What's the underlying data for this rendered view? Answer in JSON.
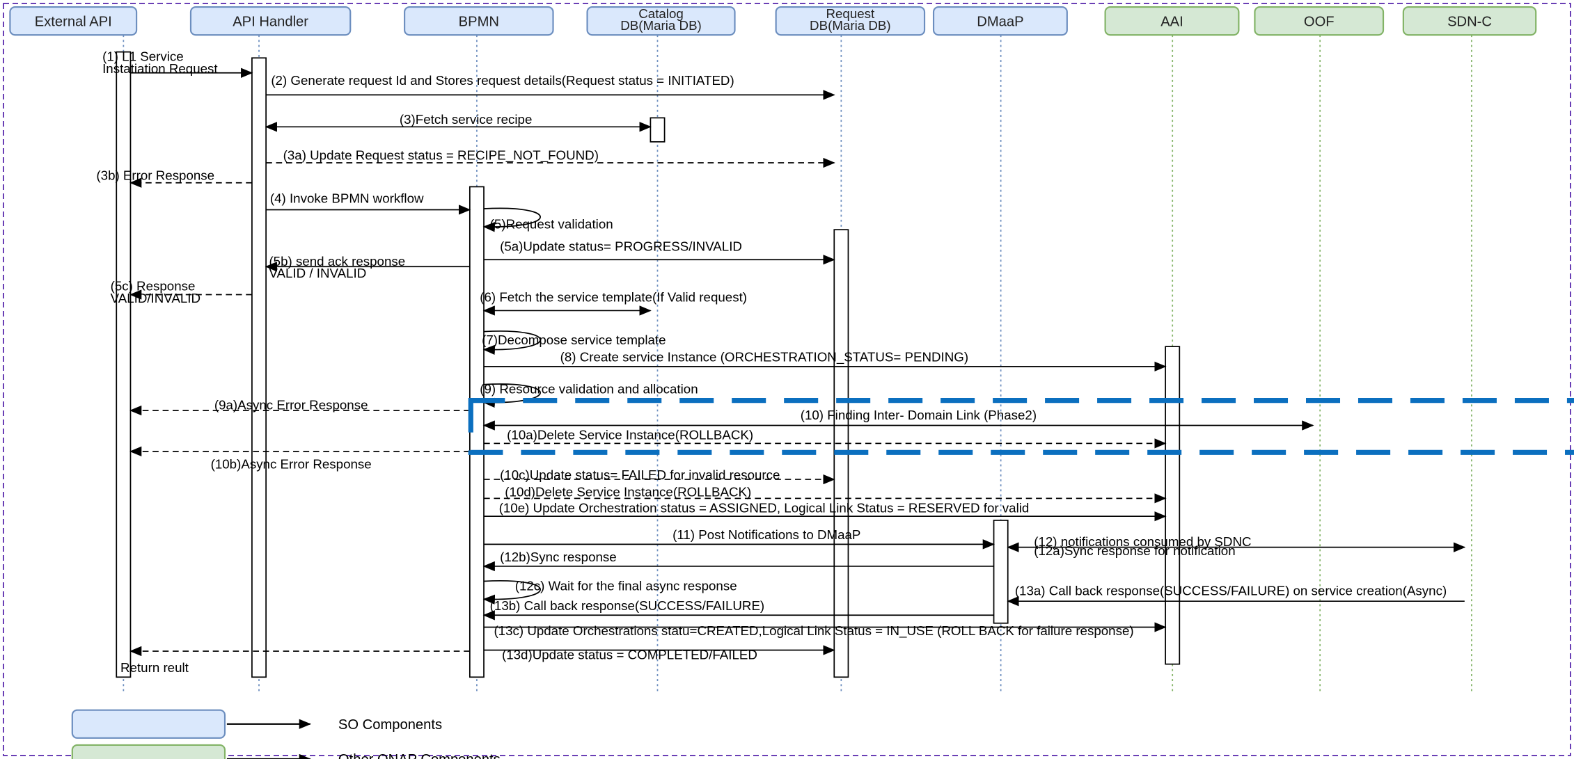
{
  "participants": [
    {
      "key": "ext",
      "label": [
        "External API"
      ],
      "group": "so"
    },
    {
      "key": "api",
      "label": [
        "API Handler"
      ],
      "group": "so"
    },
    {
      "key": "bpmn",
      "label": [
        "BPMN"
      ],
      "group": "so"
    },
    {
      "key": "cat",
      "label": [
        "Catalog",
        "DB(Maria DB)"
      ],
      "group": "so"
    },
    {
      "key": "req",
      "label": [
        "Request",
        "DB(Maria DB)"
      ],
      "group": "so"
    },
    {
      "key": "dmaap",
      "label": [
        "DMaaP"
      ],
      "group": "so"
    },
    {
      "key": "aai",
      "label": [
        "AAI"
      ],
      "group": "onap"
    },
    {
      "key": "oof",
      "label": [
        "OOF"
      ],
      "group": "onap"
    },
    {
      "key": "sdnc",
      "label": [
        "SDN-C"
      ],
      "group": "onap"
    }
  ],
  "messages": [
    {
      "id": "m1",
      "label": [
        "(1) L1 Service",
        "Instatiation Request"
      ]
    },
    {
      "id": "m2",
      "label": [
        "(2) Generate request Id and Stores request details(Request status = INITIATED)"
      ]
    },
    {
      "id": "m3",
      "label": [
        "(3)Fetch service recipe"
      ]
    },
    {
      "id": "m3a",
      "label": [
        "(3a) Update Request status = RECIPE_NOT_FOUND)"
      ]
    },
    {
      "id": "m3b",
      "label": [
        "(3b) Error Response"
      ]
    },
    {
      "id": "m4",
      "label": [
        "(4) Invoke BPMN workflow"
      ]
    },
    {
      "id": "m5",
      "label": [
        "(5)Request validation"
      ]
    },
    {
      "id": "m5a",
      "label": [
        "(5a)Update status= PROGRESS/INVALID"
      ]
    },
    {
      "id": "m5b",
      "label": [
        "(5b) send ack response",
        "VALID / INVALID"
      ]
    },
    {
      "id": "m5c",
      "label": [
        "(5c) Response",
        "VALID/INVALID"
      ]
    },
    {
      "id": "m6",
      "label": [
        "(6) Fetch the service template(If Valid request)"
      ]
    },
    {
      "id": "m7",
      "label": [
        "(7)Decompose service template"
      ]
    },
    {
      "id": "m8",
      "label": [
        "(8) Create service Instance (ORCHESTRATION_STATUS= PENDING)"
      ]
    },
    {
      "id": "m9",
      "label": [
        "(9) Resource validation and allocation"
      ]
    },
    {
      "id": "m9a",
      "label": [
        "(9a)Async Error Response"
      ]
    },
    {
      "id": "m10",
      "label": [
        "(10) Finding Inter- Domain Link (Phase2)"
      ]
    },
    {
      "id": "m10a",
      "label": [
        "(10a)Delete Service Instance(ROLLBACK)"
      ]
    },
    {
      "id": "m10b",
      "label": [
        "(10b)Async Error Response"
      ]
    },
    {
      "id": "m10c",
      "label": [
        "(10c)Update status= FAILED for invalid resource"
      ]
    },
    {
      "id": "m10d",
      "label": [
        "(10d)Delete Service Instance(ROLLBACK)"
      ]
    },
    {
      "id": "m10e",
      "label": [
        "(10e) Update Orchestration status = ASSIGNED, Logical Link Status = RESERVED for valid"
      ]
    },
    {
      "id": "m11",
      "label": [
        "(11) Post Notifications to DMaaP"
      ]
    },
    {
      "id": "m12",
      "label": [
        "(12) notifications consumed by SDNC"
      ]
    },
    {
      "id": "m12a",
      "label": [
        "(12a)Sync response for notification"
      ]
    },
    {
      "id": "m12b",
      "label": [
        "(12b)Sync response"
      ]
    },
    {
      "id": "m12c",
      "label": [
        "(12c) Wait for the final async response"
      ]
    },
    {
      "id": "m13a",
      "label": [
        "(13a) Call back response(SUCCESS/FAILURE) on service creation(Async)"
      ]
    },
    {
      "id": "m13b",
      "label": [
        "(13b) Call back response(SUCCESS/FAILURE)"
      ]
    },
    {
      "id": "m13c",
      "label": [
        "(13c) Update Orchestrations statu=CREATED,Logical Link Status = IN_USE (ROLL BACK for failure response)"
      ]
    },
    {
      "id": "m13d",
      "label": [
        "(13d)Update status = COMPLETED/FAILED"
      ]
    },
    {
      "id": "ret",
      "label": [
        "Return reult"
      ]
    }
  ],
  "legend": [
    {
      "group": "so",
      "label": "SO Components"
    },
    {
      "group": "onap",
      "label": "Other ONAP Components"
    }
  ],
  "colors": {
    "so_fill": "#dae8fc",
    "so_stroke": "#6c8ebf",
    "onap_fill": "#d5e8d4",
    "onap_stroke": "#82b366",
    "frame": "#6a3fb5",
    "highlight": "#0b6fbf",
    "lifeline": "#6c8ebf",
    "lifeline_green": "#82b366"
  }
}
